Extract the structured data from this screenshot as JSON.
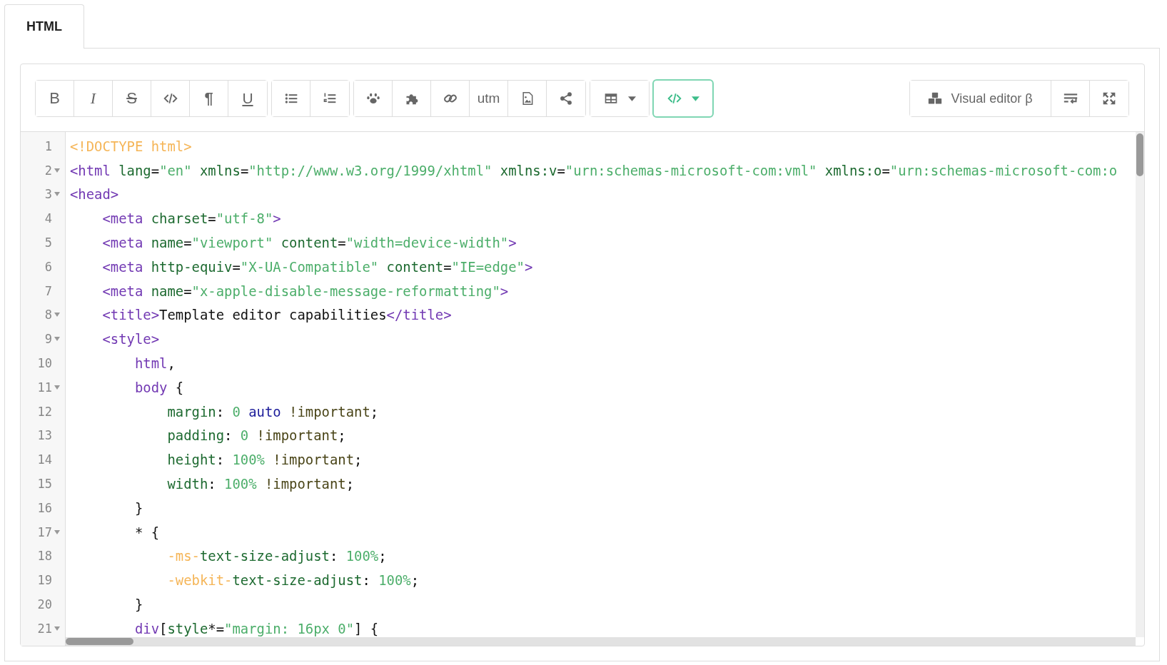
{
  "tabs": [
    {
      "label": "HTML",
      "selected": true
    }
  ],
  "toolbar": {
    "groups": [
      [
        {
          "kind": "bold",
          "label": "B"
        },
        {
          "kind": "italic",
          "label": "I"
        },
        {
          "kind": "strike",
          "label": "S"
        },
        {
          "kind": "code"
        },
        {
          "kind": "pilcrow",
          "label": "¶"
        },
        {
          "kind": "underline",
          "label": "U"
        }
      ],
      [
        {
          "kind": "bullets"
        },
        {
          "kind": "numbers"
        }
      ],
      [
        {
          "kind": "paw"
        },
        {
          "kind": "puzzle"
        },
        {
          "kind": "link"
        },
        {
          "kind": "text",
          "label": "utm"
        },
        {
          "kind": "image-file"
        },
        {
          "kind": "share"
        }
      ],
      [
        {
          "kind": "table",
          "dropdown": true
        }
      ],
      [
        {
          "kind": "source",
          "dropdown": true,
          "selected": true
        }
      ]
    ],
    "right": [
      {
        "kind": "visual",
        "label": "Visual editor β"
      },
      {
        "kind": "wrap"
      },
      {
        "kind": "fullscreen"
      }
    ]
  },
  "editor": {
    "lines": [
      {
        "number": "1",
        "fold": false,
        "tokens": [
          {
            "kind": "meta",
            "text": "<!DOCTYPE html>"
          }
        ]
      },
      {
        "number": "2",
        "fold": true,
        "tokens": [
          {
            "kind": "tag",
            "text": "<html"
          },
          {
            "kind": "attr",
            "text": " lang"
          },
          {
            "kind": "plain",
            "text": "="
          },
          {
            "kind": "str",
            "text": "\"en\""
          },
          {
            "kind": "attr",
            "text": " xmlns"
          },
          {
            "kind": "plain",
            "text": "="
          },
          {
            "kind": "str",
            "text": "\"http://www.w3.org/1999/xhtml\""
          },
          {
            "kind": "attr",
            "text": " xmlns:v"
          },
          {
            "kind": "plain",
            "text": "="
          },
          {
            "kind": "str",
            "text": "\"urn:schemas-microsoft-com:vml\""
          },
          {
            "kind": "attr",
            "text": " xmlns:o"
          },
          {
            "kind": "plain",
            "text": "="
          },
          {
            "kind": "str",
            "text": "\"urn:schemas-microsoft-com:o"
          }
        ]
      },
      {
        "number": "3",
        "fold": true,
        "tokens": [
          {
            "kind": "tag",
            "text": "<head>"
          }
        ]
      },
      {
        "number": "4",
        "fold": false,
        "tokens": [
          {
            "kind": "tag",
            "text": "    <meta"
          },
          {
            "kind": "attr",
            "text": " charset"
          },
          {
            "kind": "plain",
            "text": "="
          },
          {
            "kind": "str",
            "text": "\"utf-8\""
          },
          {
            "kind": "tag",
            "text": ">"
          }
        ]
      },
      {
        "number": "5",
        "fold": false,
        "tokens": [
          {
            "kind": "tag",
            "text": "    <meta"
          },
          {
            "kind": "attr",
            "text": " name"
          },
          {
            "kind": "plain",
            "text": "="
          },
          {
            "kind": "str",
            "text": "\"viewport\""
          },
          {
            "kind": "attr",
            "text": " content"
          },
          {
            "kind": "plain",
            "text": "="
          },
          {
            "kind": "str",
            "text": "\"width=device-width\""
          },
          {
            "kind": "tag",
            "text": ">"
          }
        ]
      },
      {
        "number": "6",
        "fold": false,
        "tokens": [
          {
            "kind": "tag",
            "text": "    <meta"
          },
          {
            "kind": "attr",
            "text": " http-equiv"
          },
          {
            "kind": "plain",
            "text": "="
          },
          {
            "kind": "str",
            "text": "\"X-UA-Compatible\""
          },
          {
            "kind": "attr",
            "text": " content"
          },
          {
            "kind": "plain",
            "text": "="
          },
          {
            "kind": "str",
            "text": "\"IE=edge\""
          },
          {
            "kind": "tag",
            "text": ">"
          }
        ]
      },
      {
        "number": "7",
        "fold": false,
        "tokens": [
          {
            "kind": "tag",
            "text": "    <meta"
          },
          {
            "kind": "attr",
            "text": " name"
          },
          {
            "kind": "plain",
            "text": "="
          },
          {
            "kind": "str",
            "text": "\"x-apple-disable-message-reformatting\""
          },
          {
            "kind": "tag",
            "text": ">"
          }
        ]
      },
      {
        "number": "8",
        "fold": true,
        "tokens": [
          {
            "kind": "tag",
            "text": "    <title>"
          },
          {
            "kind": "plain",
            "text": "Template editor capabilities"
          },
          {
            "kind": "tag",
            "text": "</title>"
          }
        ]
      },
      {
        "number": "9",
        "fold": true,
        "tokens": [
          {
            "kind": "tag",
            "text": "    <style>"
          }
        ]
      },
      {
        "number": "10",
        "fold": false,
        "tokens": [
          {
            "kind": "tag",
            "text": "        html"
          },
          {
            "kind": "plain",
            "text": ","
          }
        ]
      },
      {
        "number": "11",
        "fold": true,
        "tokens": [
          {
            "kind": "tag",
            "text": "        body"
          },
          {
            "kind": "plain",
            "text": " {"
          }
        ]
      },
      {
        "number": "12",
        "fold": false,
        "tokens": [
          {
            "kind": "prop",
            "text": "            margin"
          },
          {
            "kind": "plain",
            "text": ": "
          },
          {
            "kind": "num",
            "text": "0"
          },
          {
            "kind": "keyword",
            "text": " auto"
          },
          {
            "kind": "important",
            "text": " !important"
          },
          {
            "kind": "plain",
            "text": ";"
          }
        ]
      },
      {
        "number": "13",
        "fold": false,
        "tokens": [
          {
            "kind": "prop",
            "text": "            padding"
          },
          {
            "kind": "plain",
            "text": ": "
          },
          {
            "kind": "num",
            "text": "0"
          },
          {
            "kind": "important",
            "text": " !important"
          },
          {
            "kind": "plain",
            "text": ";"
          }
        ]
      },
      {
        "number": "14",
        "fold": false,
        "tokens": [
          {
            "kind": "prop",
            "text": "            height"
          },
          {
            "kind": "plain",
            "text": ": "
          },
          {
            "kind": "num",
            "text": "100%"
          },
          {
            "kind": "important",
            "text": " !important"
          },
          {
            "kind": "plain",
            "text": ";"
          }
        ]
      },
      {
        "number": "15",
        "fold": false,
        "tokens": [
          {
            "kind": "prop",
            "text": "            width"
          },
          {
            "kind": "plain",
            "text": ": "
          },
          {
            "kind": "num",
            "text": "100%"
          },
          {
            "kind": "important",
            "text": " !important"
          },
          {
            "kind": "plain",
            "text": ";"
          }
        ]
      },
      {
        "number": "16",
        "fold": false,
        "tokens": [
          {
            "kind": "plain",
            "text": "        }"
          }
        ]
      },
      {
        "number": "17",
        "fold": true,
        "tokens": [
          {
            "kind": "plain",
            "text": "        * {"
          }
        ]
      },
      {
        "number": "18",
        "fold": false,
        "tokens": [
          {
            "kind": "meta",
            "text": "            -ms-"
          },
          {
            "kind": "prop",
            "text": "text-size-adjust"
          },
          {
            "kind": "plain",
            "text": ": "
          },
          {
            "kind": "num",
            "text": "100%"
          },
          {
            "kind": "plain",
            "text": ";"
          }
        ]
      },
      {
        "number": "19",
        "fold": false,
        "tokens": [
          {
            "kind": "meta",
            "text": "            -webkit-"
          },
          {
            "kind": "prop",
            "text": "text-size-adjust"
          },
          {
            "kind": "plain",
            "text": ": "
          },
          {
            "kind": "num",
            "text": "100%"
          },
          {
            "kind": "plain",
            "text": ";"
          }
        ]
      },
      {
        "number": "20",
        "fold": false,
        "tokens": [
          {
            "kind": "plain",
            "text": "        }"
          }
        ]
      },
      {
        "number": "21",
        "fold": true,
        "tokens": [
          {
            "kind": "tag",
            "text": "        div"
          },
          {
            "kind": "plain",
            "text": "["
          },
          {
            "kind": "attr",
            "text": "style"
          },
          {
            "kind": "plain",
            "text": "*="
          },
          {
            "kind": "str",
            "text": "\"margin: 16px 0\""
          },
          {
            "kind": "plain",
            "text": "] {"
          }
        ]
      }
    ]
  }
}
